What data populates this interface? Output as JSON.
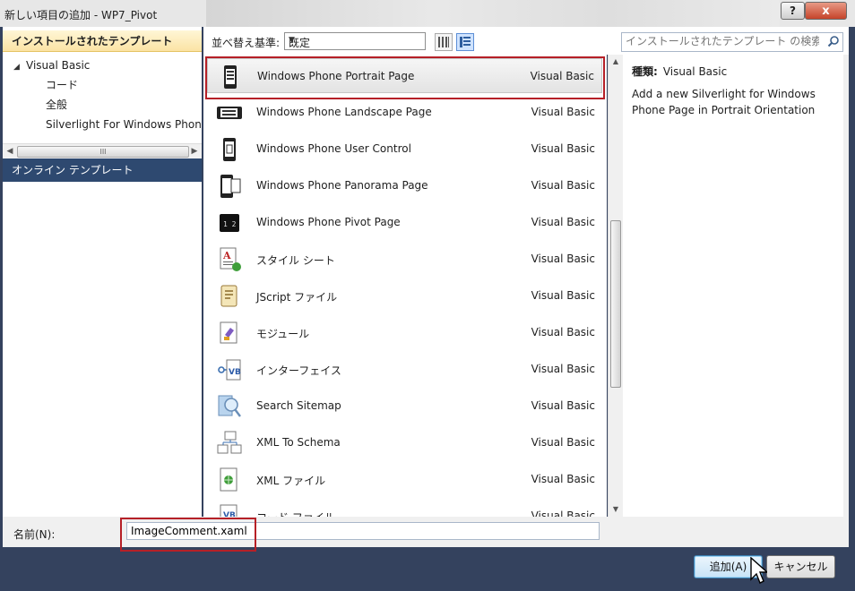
{
  "window": {
    "title": "新しい項目の追加 - WP7_Pivot",
    "help_label": "?",
    "close_label": "x"
  },
  "left": {
    "installed_header": "インストールされたテンプレート",
    "tree_root": "Visual Basic",
    "tree_children": [
      "コード",
      "全般",
      "Silverlight For Windows Phone"
    ],
    "hscroll_grip": "III",
    "online_header": "オンライン テンプレート"
  },
  "toolbar": {
    "sort_label": "並べ替え基準:",
    "sort_value": "既定",
    "search_placeholder": "インストールされたテンプレート の検索"
  },
  "templates": [
    {
      "name": "Windows Phone Portrait Page",
      "lang": "Visual Basic",
      "icon": "phone-portrait-icon",
      "selected": true
    },
    {
      "name": "Windows Phone Landscape Page",
      "lang": "Visual Basic",
      "icon": "phone-landscape-icon"
    },
    {
      "name": "Windows Phone User Control",
      "lang": "Visual Basic",
      "icon": "phone-user-control-icon"
    },
    {
      "name": "Windows Phone Panorama Page",
      "lang": "Visual Basic",
      "icon": "phone-panorama-icon"
    },
    {
      "name": "Windows Phone Pivot Page",
      "lang": "Visual Basic",
      "icon": "phone-pivot-icon"
    },
    {
      "name": "スタイル シート",
      "lang": "Visual Basic",
      "icon": "stylesheet-icon"
    },
    {
      "name": "JScript ファイル",
      "lang": "Visual Basic",
      "icon": "jscript-file-icon"
    },
    {
      "name": "モジュール",
      "lang": "Visual Basic",
      "icon": "module-icon"
    },
    {
      "name": "インターフェイス",
      "lang": "Visual Basic",
      "icon": "interface-icon"
    },
    {
      "name": "Search Sitemap",
      "lang": "Visual Basic",
      "icon": "search-sitemap-icon"
    },
    {
      "name": "XML To Schema",
      "lang": "Visual Basic",
      "icon": "xml-to-schema-icon"
    },
    {
      "name": "XML ファイル",
      "lang": "Visual Basic",
      "icon": "xml-file-icon"
    },
    {
      "name": "コード ファイル",
      "lang": "Visual Basic",
      "icon": "code-file-icon"
    }
  ],
  "details": {
    "kind_label": "種類:",
    "kind_value": "Visual Basic",
    "description": "Add a new Silverlight for Windows Phone Page in Portrait Orientation"
  },
  "bottom": {
    "name_label": "名前(N):",
    "name_value": "ImageComment.xaml",
    "add_label": "追加(A)",
    "cancel_label": "キャンセル"
  },
  "colors": {
    "accent_outline": "#b62027",
    "online_header_bg": "#2e4970",
    "frame_bg": "#34425e"
  }
}
